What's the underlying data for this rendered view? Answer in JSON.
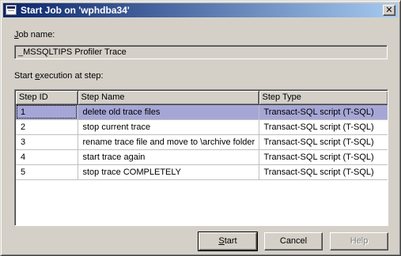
{
  "window": {
    "title": "Start Job on 'wphdba34'",
    "close_glyph": "✕"
  },
  "job": {
    "label_prefix": "",
    "label_mnemonic": "J",
    "label_rest": "ob name:",
    "value": "_MSSQLTIPS Profiler Trace"
  },
  "steps_section": {
    "label_before": "Start ",
    "label_mnemonic": "e",
    "label_after": "xecution at step:"
  },
  "grid": {
    "columns": [
      "Step ID",
      "Step Name",
      "Step Type"
    ],
    "rows": [
      {
        "id": "1",
        "name": "delete old trace files",
        "type": "Transact-SQL script (T-SQL)"
      },
      {
        "id": "2",
        "name": "stop current trace",
        "type": "Transact-SQL script (T-SQL)"
      },
      {
        "id": "3",
        "name": "rename trace file and move to \\archive folder",
        "type": "Transact-SQL script (T-SQL)"
      },
      {
        "id": "4",
        "name": "start trace again",
        "type": "Transact-SQL script (T-SQL)"
      },
      {
        "id": "5",
        "name": "stop trace COMPLETELY",
        "type": "Transact-SQL script (T-SQL)"
      }
    ],
    "selected_row": "1"
  },
  "buttons": {
    "start_mnemonic": "S",
    "start_rest": "tart",
    "cancel": "Cancel",
    "help": "Help"
  },
  "colors": {
    "selection": "#a6a6d6",
    "title_start": "#0a246a",
    "title_end": "#a6caf0",
    "face": "#d4d0c8"
  },
  "icons": {
    "app": "sql-agent-window-icon",
    "close": "close-icon"
  }
}
